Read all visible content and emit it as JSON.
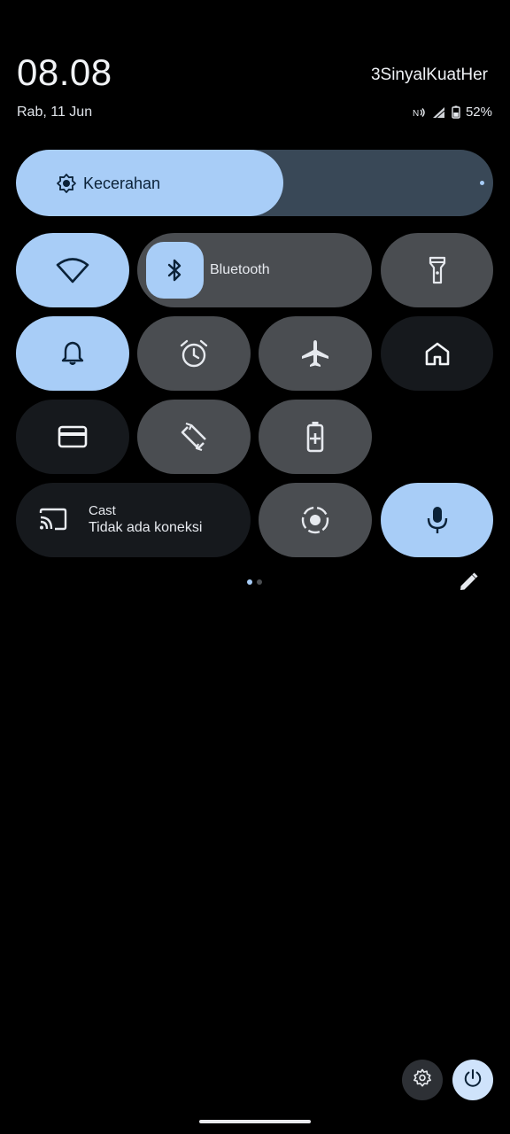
{
  "header": {
    "time": "08.08",
    "carrier": "3SinyalKuatHer",
    "date": "Rab, 11 Jun",
    "battery": "52%"
  },
  "brightness": {
    "label": "Kecerahan",
    "level_percent": 56,
    "icon": "brightness-icon"
  },
  "tiles": [
    {
      "name": "wifi",
      "icon": "wifi-icon",
      "state": "on"
    },
    {
      "name": "bluetooth",
      "icon": "bluetooth-icon",
      "state": "on",
      "label": "Bluetooth"
    },
    {
      "name": "flashlight",
      "icon": "flashlight-icon",
      "state": "off"
    },
    {
      "name": "sound",
      "icon": "bell-icon",
      "state": "on"
    },
    {
      "name": "alarm",
      "icon": "alarm-icon",
      "state": "off"
    },
    {
      "name": "airplane-mode",
      "icon": "airplane-icon",
      "state": "off"
    },
    {
      "name": "home",
      "icon": "home-icon",
      "state": "unavailable"
    },
    {
      "name": "wallet",
      "icon": "card-icon",
      "state": "unavailable"
    },
    {
      "name": "auto-rotate",
      "icon": "rotate-icon",
      "state": "off"
    },
    {
      "name": "battery-saver",
      "icon": "battery-saver-icon",
      "state": "off"
    },
    {
      "name": "cast",
      "icon": "cast-icon",
      "state": "unavailable",
      "label": "Cast",
      "sublabel": "Tidak ada koneksi"
    },
    {
      "name": "screen-record",
      "icon": "screen-record-icon",
      "state": "off"
    },
    {
      "name": "mic-access",
      "icon": "mic-icon",
      "state": "on"
    }
  ],
  "pager": {
    "pages": 2,
    "current": 1
  },
  "colors": {
    "accent": "#a8cdf7",
    "tile_off": "#4a4d51",
    "tile_unavailable": "#16191d",
    "background": "#000000"
  }
}
